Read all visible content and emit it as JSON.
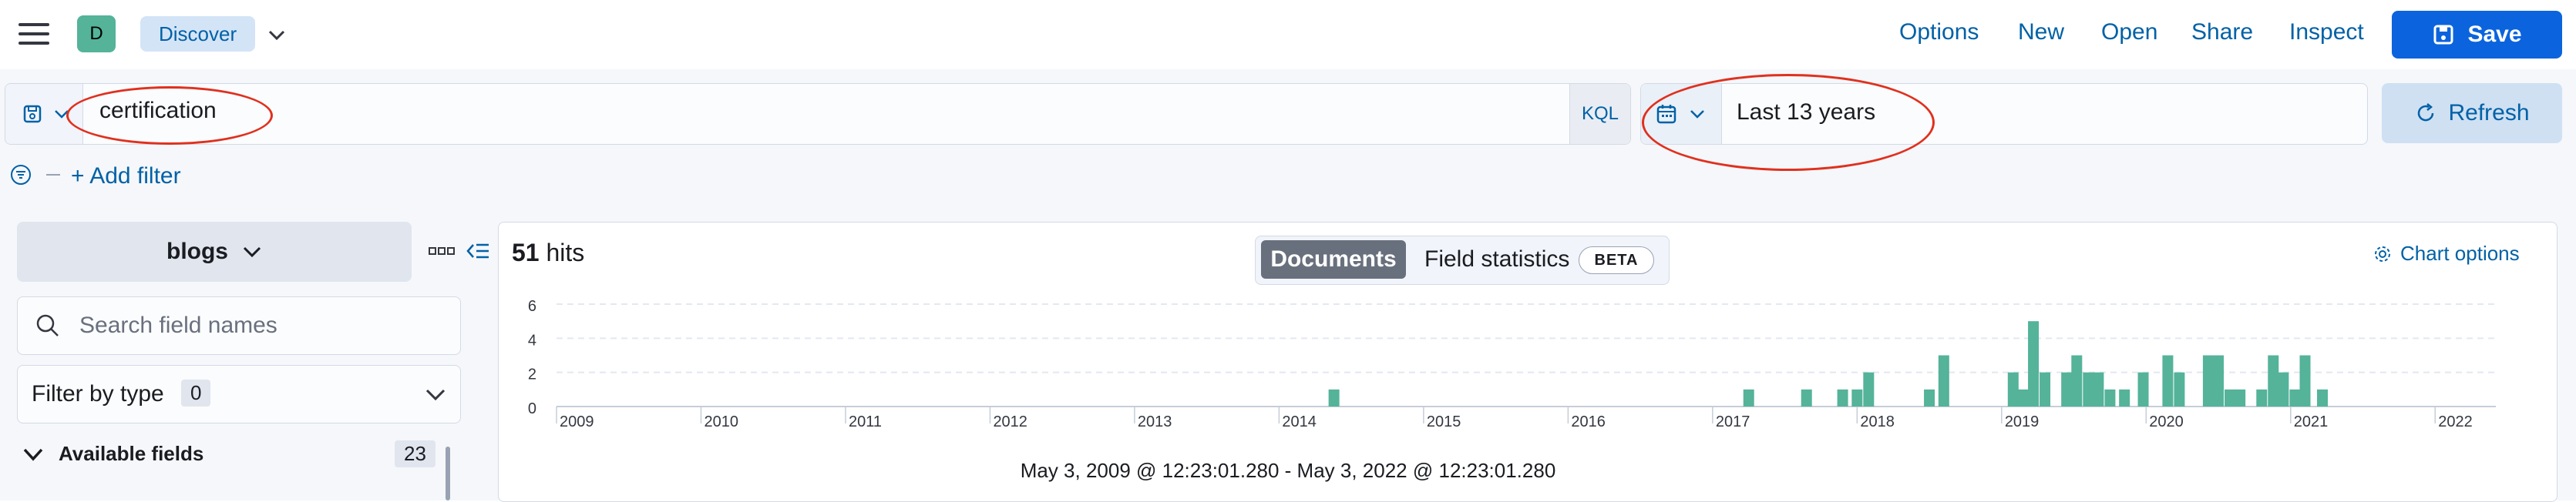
{
  "header": {
    "space_initial": "D",
    "breadcrumb": "Discover",
    "links": [
      "Options",
      "New",
      "Open",
      "Share",
      "Inspect"
    ],
    "save_label": "Save"
  },
  "query": {
    "value": "certification",
    "language": "KQL"
  },
  "date_picker": {
    "value": "Last 13 years",
    "refresh_label": "Refresh"
  },
  "filters": {
    "add_filter_label": "+ Add filter"
  },
  "sidebar": {
    "index_pattern": "blogs",
    "search_placeholder": "Search field names",
    "filter_by_type_label": "Filter by type",
    "filter_by_type_count": "0",
    "available_fields_label": "Available fields",
    "available_fields_count": "23"
  },
  "main": {
    "hits_count": "51",
    "hits_label": "hits",
    "tabs": [
      "Documents",
      "Field statistics"
    ],
    "beta_label": "BETA",
    "chart_options_label": "Chart options",
    "time_range_text": "May 3, 2009 @ 12:23:01.280 - May 3, 2022 @ 12:23:01.280"
  },
  "colors": {
    "accent": "#0b64dd",
    "bar": "#54b399",
    "annotation": "#e0301e"
  },
  "chart_data": {
    "type": "bar",
    "title": "",
    "xlabel": "",
    "ylabel": "",
    "ylim": [
      0,
      6
    ],
    "yticks": [
      0,
      2,
      4,
      6
    ],
    "xticks": [
      "2009",
      "2010",
      "2011",
      "2012",
      "2013",
      "2014",
      "2015",
      "2016",
      "2017",
      "2018",
      "2019",
      "2020",
      "2021",
      "2022"
    ],
    "x": [
      2014.38,
      2017.25,
      2017.65,
      2017.9,
      2018.0,
      2018.08,
      2018.5,
      2018.6,
      2019.08,
      2019.15,
      2019.22,
      2019.3,
      2019.45,
      2019.52,
      2019.6,
      2019.67,
      2019.75,
      2019.85,
      2019.98,
      2020.15,
      2020.23,
      2020.43,
      2020.5,
      2020.58,
      2020.65,
      2020.8,
      2020.88,
      2020.95,
      2021.03,
      2021.1,
      2021.22
    ],
    "values": [
      1,
      1,
      1,
      1,
      1,
      2,
      1,
      3,
      2,
      1,
      5,
      2,
      2,
      3,
      2,
      2,
      1,
      1,
      2,
      3,
      2,
      3,
      3,
      1,
      1,
      1,
      3,
      2,
      1,
      3,
      1
    ]
  }
}
